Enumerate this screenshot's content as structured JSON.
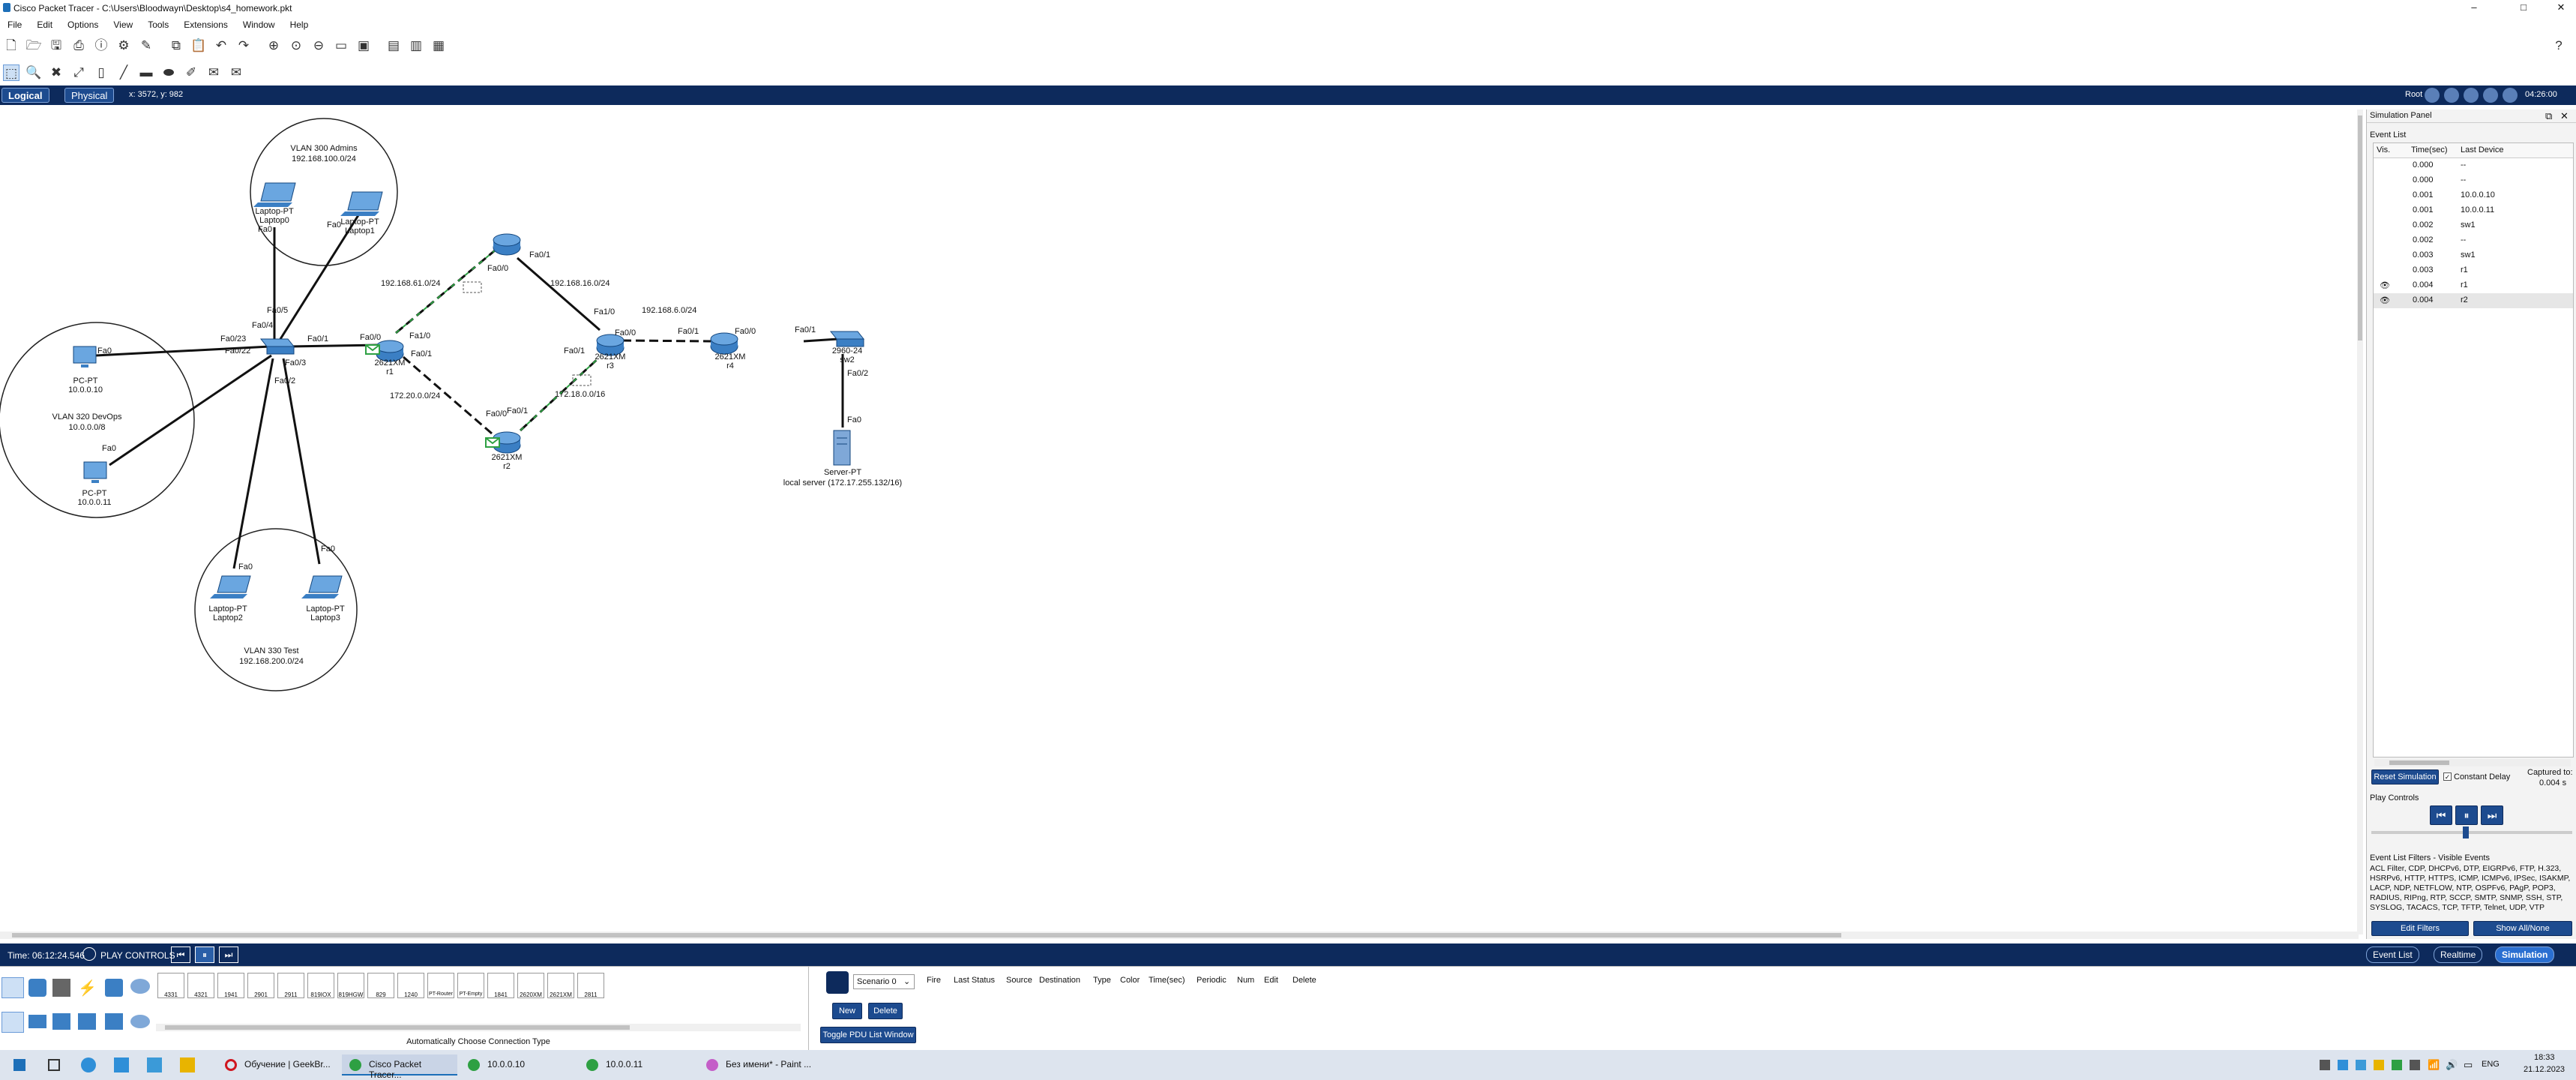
{
  "window": {
    "title": "Cisco Packet Tracer - C:\\Users\\Bloodwayn\\Desktop\\s4_homework.pkt",
    "minimize": "–",
    "maximize": "□",
    "close": "✕"
  },
  "menu": [
    "File",
    "Edit",
    "Options",
    "View",
    "Tools",
    "Extensions",
    "Window",
    "Help"
  ],
  "nav": {
    "logical": "Logical",
    "physical": "Physical",
    "coords": "x: 3572, y: 982",
    "root": "Root",
    "clock": "04:26:00"
  },
  "topology": {
    "zones": [
      {
        "name": "VLAN 300 Admins",
        "net": "192.168.100.0/24"
      },
      {
        "name": "VLAN 320 DevOps",
        "net": "10.0.0.0/8"
      },
      {
        "name": "VLAN 330 Test",
        "net": "192.168.200.0/24"
      }
    ],
    "devices": {
      "laptop0": {
        "type": "Laptop-PT",
        "name": "Laptop0",
        "port": "Fa0"
      },
      "laptop1": {
        "type": "Laptop-PT",
        "name": "Laptop1",
        "port": "Fa0"
      },
      "pc0": {
        "type": "PC-PT",
        "ip": "10.0.0.10",
        "port": "Fa0"
      },
      "pc1": {
        "type": "PC-PT",
        "ip": "10.0.0.11",
        "port": "Fa0"
      },
      "laptop2": {
        "type": "Laptop-PT",
        "name": "Laptop2",
        "port": "Fa0"
      },
      "laptop3": {
        "type": "Laptop-PT",
        "name": "Laptop3",
        "port": "Fa0"
      },
      "sw1": {
        "ports": [
          "Fa0/5",
          "Fa0/4",
          "Fa0/23",
          "Fa0/22",
          "Fa0/3",
          "Fa0/2",
          "Fa0/1"
        ]
      },
      "r1": {
        "model": "2621XM",
        "name": "r1",
        "ports": [
          "Fa0/0",
          "Fa1/0",
          "Fa0/1"
        ]
      },
      "r_top": {
        "ports": [
          "Fa0/0",
          "Fa0/1"
        ]
      },
      "r2": {
        "model": "2621XM",
        "name": "r2",
        "ports": [
          "Fa0/0",
          "Fa0/1"
        ]
      },
      "r3": {
        "model": "2621XM",
        "name": "r3",
        "ports": [
          "Fa1/0",
          "Fa0/0",
          "Fa0/1"
        ]
      },
      "r4": {
        "model": "2621XM",
        "name": "r4",
        "ports": [
          "Fa0/1",
          "Fa0/0"
        ]
      },
      "sw2": {
        "model": "2960-24",
        "name": "sw2",
        "ports": [
          "Fa0/1",
          "Fa0/2"
        ]
      },
      "server": {
        "type": "Server-PT",
        "label": "local server (172.17.255.132/16)",
        "port": "Fa0"
      }
    },
    "networks": [
      "192.168.61.0/24",
      "192.168.16.0/24",
      "192.168.6.0/24",
      "172.20.0.0/24",
      "172.18.0.0/16"
    ]
  },
  "sim_panel": {
    "title": "Simulation Panel",
    "event_list_label": "Event List",
    "columns": [
      "Vis.",
      "Time(sec)",
      "Last Device"
    ],
    "events": [
      {
        "time": "0.000",
        "dev": "--"
      },
      {
        "time": "0.000",
        "dev": "--"
      },
      {
        "time": "0.001",
        "dev": "10.0.0.10"
      },
      {
        "time": "0.001",
        "dev": "10.0.0.11"
      },
      {
        "time": "0.002",
        "dev": "sw1"
      },
      {
        "time": "0.002",
        "dev": "--"
      },
      {
        "time": "0.003",
        "dev": "sw1"
      },
      {
        "time": "0.003",
        "dev": "r1"
      },
      {
        "time": "0.004",
        "dev": "r1"
      },
      {
        "time": "0.004",
        "dev": "r2"
      }
    ],
    "reset": "Reset Simulation",
    "constant_delay": "Constant Delay",
    "captured_label": "Captured to:",
    "captured_value": "0.004 s",
    "play_controls": "Play Controls",
    "filters_title": "Event List Filters - Visible Events",
    "filters_text": "ACL Filter, CDP, DHCPv6, DTP, EIGRPv6, FTP, H.323, HSRPv6, HTTP, HTTPS, ICMP, ICMPv6, IPSec, ISAKMP, LACP, NDP, NETFLOW, NTP, OSPFv6, PAgP, POP3, RADIUS, RIPng, RTP, SCCP, SMTP, SNMP, SSH, STP, SYSLOG, TACACS, TCP, TFTP, Telnet, UDP, VTP",
    "edit_filters": "Edit Filters",
    "show_all": "Show All/None"
  },
  "bottom_bar": {
    "time": "Time: 06:12:24.546",
    "play_controls": "PLAY CONTROLS",
    "event_list": "Event List",
    "realtime": "Realtime",
    "simulation": "Simulation"
  },
  "device_models": [
    "4331",
    "4321",
    "1941",
    "2901",
    "2911",
    "819IOX",
    "819HGW",
    "829",
    "1240",
    "PT-Router",
    "PT-Empty",
    "1841",
    "2620XM",
    "2621XM",
    "2811"
  ],
  "bottom_panel": {
    "auto_conn": "Automatically Choose Connection Type",
    "scenario": "Scenario 0",
    "new": "New",
    "delete": "Delete",
    "toggle": "Toggle PDU List Window",
    "pdu_columns": [
      "Fire",
      "Last Status",
      "Source",
      "Destination",
      "Type",
      "Color",
      "Time(sec)",
      "Periodic",
      "Num",
      "Edit",
      "Delete"
    ]
  },
  "taskbar": {
    "tasks": [
      "Обучение | GeekBr...",
      "Cisco Packet Tracer...",
      "10.0.0.10",
      "10.0.0.11",
      "Без имени* - Paint ..."
    ],
    "lang": "ENG",
    "time": "18:33",
    "date": "21.12.2023"
  }
}
